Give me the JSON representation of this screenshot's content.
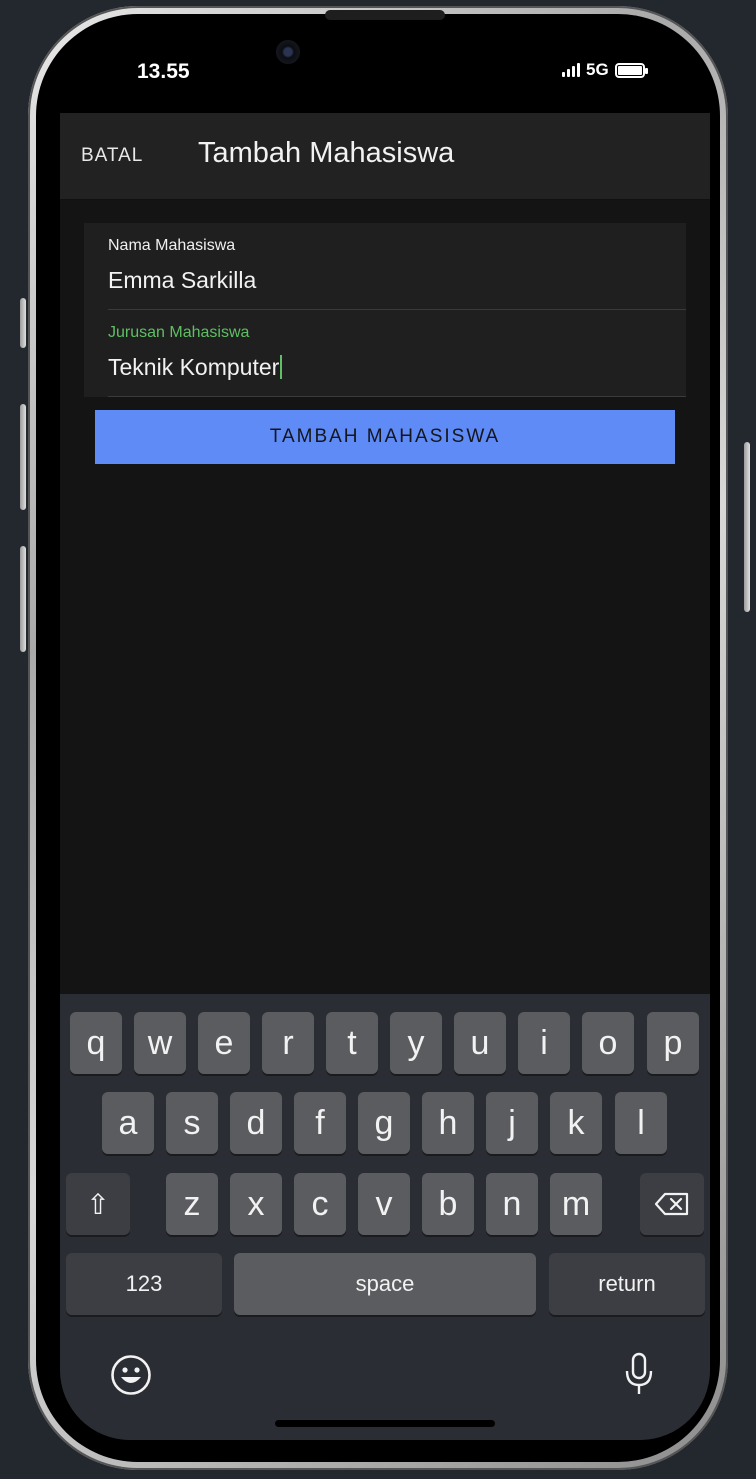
{
  "status_bar": {
    "time": "13.55",
    "network": "5G"
  },
  "app_bar": {
    "cancel_label": "BATAL",
    "title": "Tambah Mahasiswa"
  },
  "form": {
    "name_field": {
      "label": "Nama Mahasiswa",
      "value": "Emma Sarkilla"
    },
    "major_field": {
      "label": "Jurusan Mahasiswa",
      "value": "Teknik Komputer"
    },
    "submit_label": "TAMBAH MAHASISWA"
  },
  "keyboard": {
    "row1": [
      "q",
      "w",
      "e",
      "r",
      "t",
      "y",
      "u",
      "i",
      "o",
      "p"
    ],
    "row2": [
      "a",
      "s",
      "d",
      "f",
      "g",
      "h",
      "j",
      "k",
      "l"
    ],
    "row3": [
      "z",
      "x",
      "c",
      "v",
      "b",
      "n",
      "m"
    ],
    "numbers_label": "123",
    "space_label": "space",
    "return_label": "return",
    "shift_glyph": "⇧"
  },
  "colors": {
    "accent_green": "#5fbf64",
    "button_blue": "#5f8bf7",
    "app_bar_bg": "#222222",
    "screen_bg": "#141414"
  }
}
